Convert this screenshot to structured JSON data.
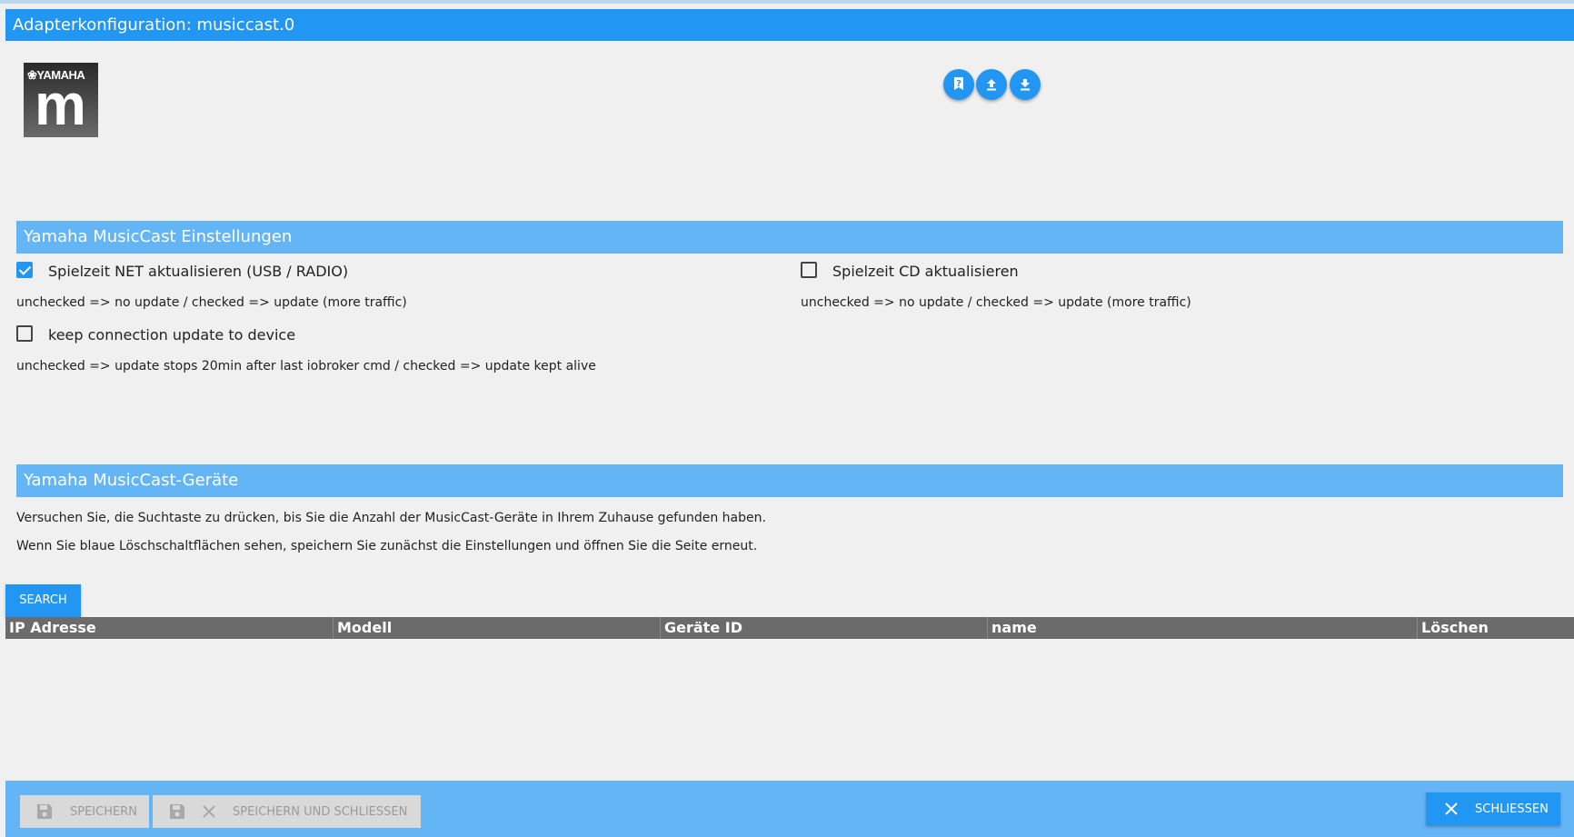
{
  "window": {
    "title": "Adapterkonfiguration: musiccast.0"
  },
  "logo": {
    "brand": "YAMAHA",
    "mark": "m"
  },
  "toolbar": [
    {
      "name": "help-button",
      "icon": "help-icon"
    },
    {
      "name": "upload-button",
      "icon": "upload-icon"
    },
    {
      "name": "download-button",
      "icon": "download-icon"
    }
  ],
  "settings": {
    "title": "Yamaha MusicCast Einstellungen",
    "net": {
      "label": "Spielzeit NET aktualisieren (USB / RADIO)",
      "checked": true,
      "hint": "unchecked => no update / checked => update (more traffic)"
    },
    "cd": {
      "label": "Spielzeit CD aktualisieren",
      "checked": false,
      "hint": "unchecked => no update / checked => update (more traffic)"
    },
    "keep": {
      "label": "keep connection update to device",
      "checked": false,
      "hint": "unchecked => update stops 20min after last iobroker cmd / checked => update kept alive"
    }
  },
  "devices": {
    "title": "Yamaha MusicCast-Geräte",
    "info1": "Versuchen Sie, die Suchtaste zu drücken, bis Sie die Anzahl der MusicCast-Geräte in Ihrem Zuhause gefunden haben.",
    "info2": "Wenn Sie blaue Löschschaltflächen sehen, speichern Sie zunächst die Einstellungen und öffnen Sie die Seite erneut.",
    "search_label": "SEARCH",
    "columns": [
      "IP Adresse",
      "Modell",
      "Geräte ID",
      "name",
      "Löschen"
    ],
    "rows": []
  },
  "footer": {
    "save_label": "SPEICHERN",
    "save_close_label": "SPEICHERN UND SCHLIESSEN",
    "close_label": "SCHLIESSEN"
  },
  "colors": {
    "primary": "#2196f3",
    "section": "#64b5f6",
    "tablehead": "#6b6b6b"
  }
}
